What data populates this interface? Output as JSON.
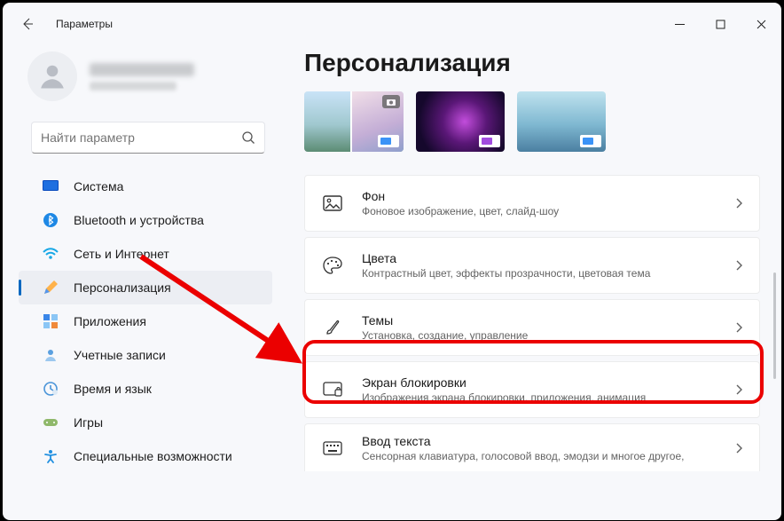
{
  "titlebar": {
    "title": "Параметры"
  },
  "search": {
    "placeholder": "Найти параметр"
  },
  "sidebar": {
    "items": [
      {
        "label": "Система"
      },
      {
        "label": "Bluetooth и устройства"
      },
      {
        "label": "Сеть и Интернет"
      },
      {
        "label": "Персонализация"
      },
      {
        "label": "Приложения"
      },
      {
        "label": "Учетные записи"
      },
      {
        "label": "Время и язык"
      },
      {
        "label": "Игры"
      },
      {
        "label": "Специальные возможности"
      }
    ]
  },
  "main": {
    "title": "Персонализация",
    "cards": [
      {
        "title": "Фон",
        "sub": "Фоновое изображение, цвет, слайд-шоу"
      },
      {
        "title": "Цвета",
        "sub": "Контрастный цвет, эффекты прозрачности, цветовая тема"
      },
      {
        "title": "Темы",
        "sub": "Установка, создание, управление"
      },
      {
        "title": "Экран блокировки",
        "sub": "Изображения экрана блокировки, приложения, анимация"
      },
      {
        "title": "Ввод текста",
        "sub": "Сенсорная клавиатура, голосовой ввод, эмодзи и многое другое,"
      }
    ]
  }
}
